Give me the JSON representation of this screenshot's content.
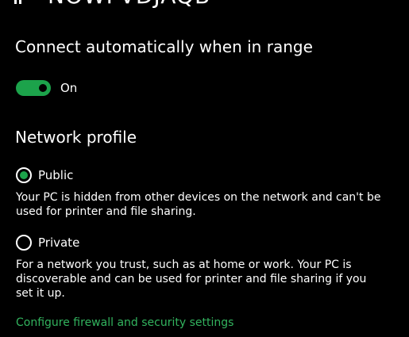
{
  "colors": {
    "accent": "#1ca34b",
    "link": "#32b35e",
    "background": "#000000",
    "text": "#ffffff"
  },
  "header": {
    "network_name": "NOWFVDJAQB",
    "icon": "wifi-icon"
  },
  "auto_connect": {
    "heading": "Connect automatically when in range",
    "toggle_state_label": "On",
    "toggle_on": true
  },
  "network_profile": {
    "heading": "Network profile",
    "options": [
      {
        "label": "Public",
        "selected": true,
        "description": "Your PC is hidden from other devices on the network and can't be used for printer and file sharing."
      },
      {
        "label": "Private",
        "selected": false,
        "description": "For a network you trust, such as at home or work. Your PC is discoverable and can be used for printer and file sharing if you set it up."
      }
    ]
  },
  "firewall_link": "Configure firewall and security settings"
}
